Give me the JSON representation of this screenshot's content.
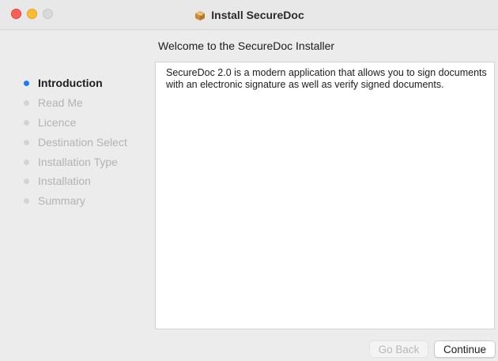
{
  "window": {
    "title": "Install SecureDoc",
    "icon": "installer-package-icon"
  },
  "sidebar": {
    "steps": [
      {
        "label": "Introduction",
        "active": true
      },
      {
        "label": "Read Me",
        "active": false
      },
      {
        "label": "Licence",
        "active": false
      },
      {
        "label": "Destination Select",
        "active": false
      },
      {
        "label": "Installation Type",
        "active": false
      },
      {
        "label": "Installation",
        "active": false
      },
      {
        "label": "Summary",
        "active": false
      }
    ]
  },
  "main": {
    "heading": "Welcome to the SecureDoc Installer",
    "body_text": "SecureDoc 2.0 is a modern application that allows you to sign documents with an electronic signature as well as verify signed documents."
  },
  "buttons": {
    "back_label": "Go Back",
    "back_enabled": false,
    "continue_label": "Continue",
    "continue_enabled": true
  },
  "colors": {
    "active_step_dot": "#1a7cf5",
    "inactive_step": "#b3b3b3"
  }
}
